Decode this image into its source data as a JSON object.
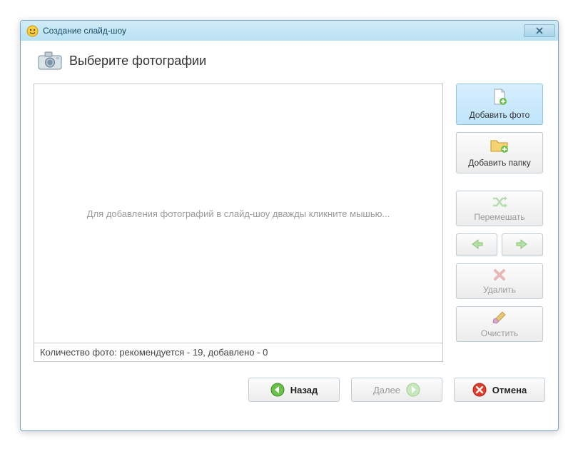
{
  "window": {
    "title": "Создание слайд-шоу"
  },
  "page": {
    "title": "Выберите фотографии"
  },
  "photoArea": {
    "placeholder": "Для добавления фотографий в слайд-шоу дважды кликните мышью...",
    "status": "Количество фото: рекомендуется - 19, добавлено - 0"
  },
  "side": {
    "addPhoto": "Добавить фото",
    "addFolder": "Добавить папку",
    "shuffle": "Перемешать",
    "delete": "Удалить",
    "clear": "Очистить"
  },
  "footer": {
    "back": "Назад",
    "next": "Далее",
    "cancel": "Отмена"
  },
  "icons": {
    "addPhoto": "page-add-icon",
    "addFolder": "folder-add-icon",
    "shuffle": "shuffle-icon",
    "left": "arrow-left-icon",
    "right": "arrow-right-icon",
    "delete": "delete-x-icon",
    "clear": "brush-icon",
    "back": "arrow-left-circle-icon",
    "next": "arrow-right-circle-icon",
    "cancel": "cancel-circle-icon",
    "camera": "camera-icon",
    "app": "app-smiley-icon",
    "close": "close-icon"
  },
  "colors": {
    "titlebar": "#b9e1f4",
    "primaryBtn": "#bfe4fb",
    "disabled": "#9a9a9a"
  }
}
